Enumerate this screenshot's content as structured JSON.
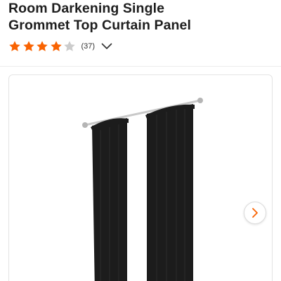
{
  "product": {
    "title_line_1": "Room Darkening Single",
    "title_line_2": "Grommet Top Curtain Panel"
  },
  "rating": {
    "stars": 4,
    "max_stars": 5,
    "review_count_text": "(37)",
    "star_color": "#f96302",
    "empty_star_color": "#cccccc"
  },
  "icons": {
    "expand": "chevron-down-icon",
    "next": "chevron-right-icon",
    "star": "star-icon"
  },
  "colors": {
    "accent": "#f96302",
    "curtain": "#1c1c1c",
    "rod": "#c9c9c9"
  }
}
